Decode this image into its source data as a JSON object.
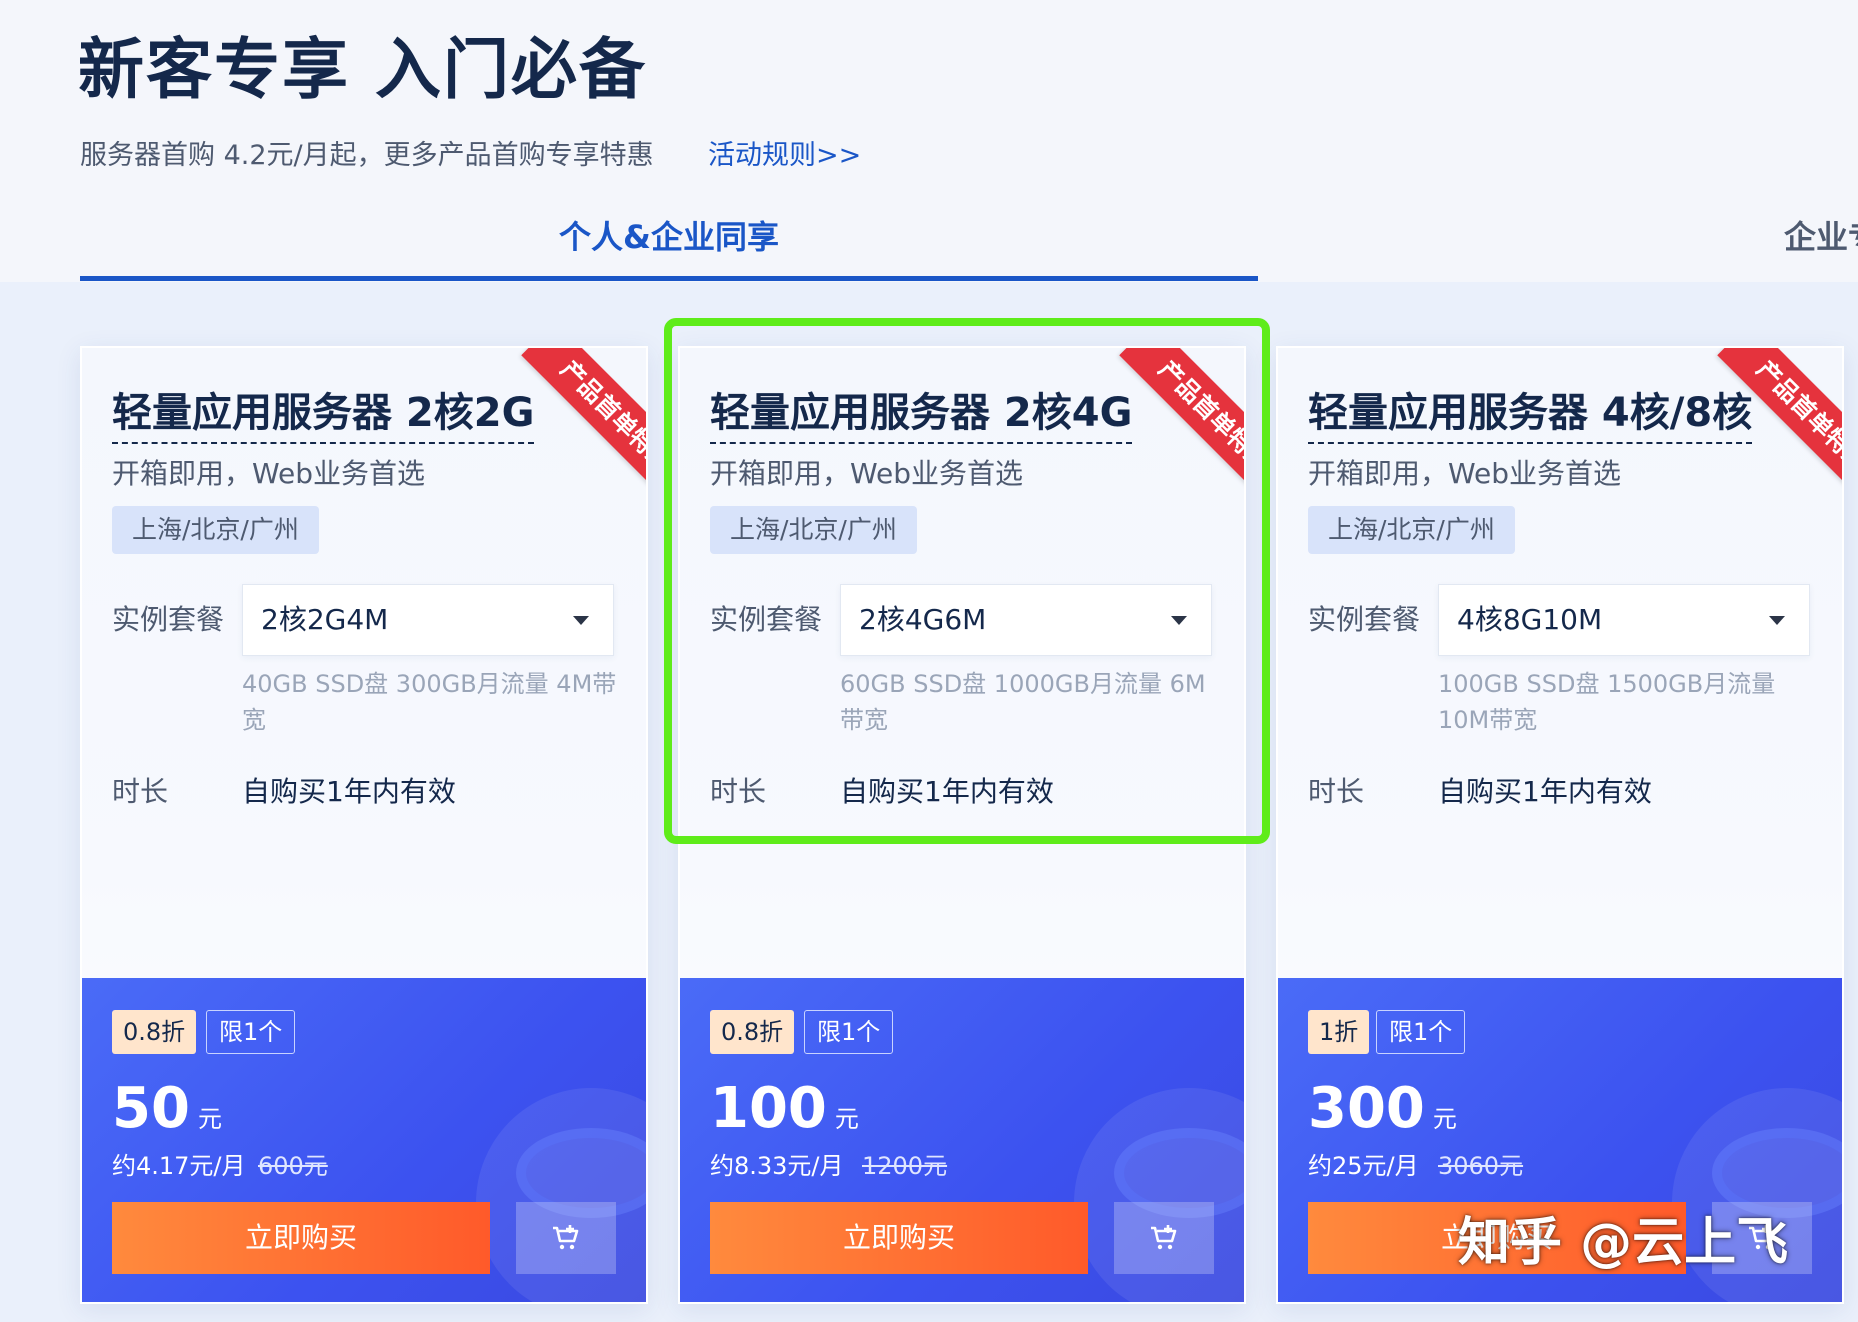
{
  "header": {
    "title": "新客专享 入门必备",
    "subtitle": "服务器首购 4.2元/月起，更多产品首购专享特惠",
    "rules_link": "活动规则>>"
  },
  "tabs": [
    {
      "label": "个人&企业同享",
      "active": true
    },
    {
      "label": "企业专享",
      "active": false
    }
  ],
  "labels": {
    "package": "实例套餐",
    "duration": "时长",
    "buy": "立即购买"
  },
  "cards": [
    {
      "ribbon": "产品首单特惠",
      "name": "轻量应用服务器 2核2G",
      "desc": "开箱即用，Web业务首选",
      "region": "上海/北京/广州",
      "package": "2核2G4M",
      "spec": "40GB SSD盘 300GB月流量 4M带宽",
      "duration": "自购买1年内有效",
      "discount": "0.8折",
      "limit": "限1个",
      "price": "50",
      "unit": "元",
      "monthly": "约4.17元/月",
      "original": "600元"
    },
    {
      "ribbon": "产品首单特惠",
      "name": "轻量应用服务器 2核4G",
      "desc": "开箱即用，Web业务首选",
      "region": "上海/北京/广州",
      "package": "2核4G6M",
      "spec": "60GB SSD盘 1000GB月流量 6M带宽",
      "duration": "自购买1年内有效",
      "discount": "0.8折",
      "limit": "限1个",
      "price": "100",
      "unit": "元",
      "monthly": "约8.33元/月",
      "original": "1200元"
    },
    {
      "ribbon": "产品首单特惠",
      "name": "轻量应用服务器 4核/8核",
      "desc": "开箱即用，Web业务首选",
      "region": "上海/北京/广州",
      "package": "4核8G10M",
      "spec": "100GB SSD盘 1500GB月流量 10M带宽",
      "duration": "自购买1年内有效",
      "discount": "1折",
      "limit": "限1个",
      "price": "300",
      "unit": "元",
      "monthly": "约25元/月",
      "original": "3060元"
    }
  ],
  "watermark": "知乎 @云上飞",
  "colors": {
    "accent": "#1a56c7",
    "ribbon": "#e5333d",
    "price_panel": "#3c52f0",
    "buy_button": "#ff6a2e",
    "highlight_border": "#5fec1a"
  }
}
